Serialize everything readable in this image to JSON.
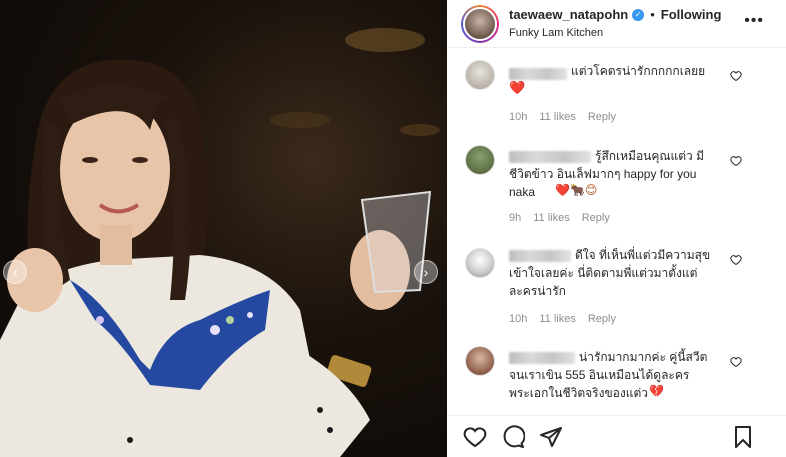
{
  "post": {
    "username": "taewaew_natapohn",
    "separator": "•",
    "follow_status": "Following",
    "location": "Funky Lam Kitchen",
    "more_label": "•••"
  },
  "comments": [
    {
      "text": "แต่วโคตรน่ารักกกกกเลยย",
      "emoji": "❤️",
      "emoji_color": "#d9272e",
      "time": "10h",
      "likes": "11 likes",
      "reply": "Reply"
    },
    {
      "text": "รู้สึกเหมือนคุณแต่ว มีชีวิตข้าว อินเล็ฟมากๆ happy for you naka",
      "emoji": "❤️🐂😊",
      "emoji_color": "#b35a1f",
      "time": "9h",
      "likes": "11 likes",
      "reply": "Reply"
    },
    {
      "text": "ดีใจ ที่เห็นพี่แต่วมีความสุข เข้าใจเลยค่ะ นี่ติดตามพี่แต่วมาตั้งแต่ละครน่ารัก",
      "emoji": "",
      "emoji_color": "#262626",
      "time": "10h",
      "likes": "11 likes",
      "reply": "Reply"
    },
    {
      "text": "น่ารักมากมากค่ะ คู่นี้สวีตจนเราเขิน 555 อินเหมือนได้ดูละครพระเอกในชีวิตจริงของแต่ว",
      "emoji": "💔",
      "emoji_color": "#c2185b",
      "time": "",
      "likes": "",
      "reply": ""
    }
  ],
  "icons": {
    "like": "heart-icon",
    "comment": "comment-icon",
    "share": "share-icon",
    "save": "bookmark-icon",
    "prev": "chevron-left-icon",
    "next": "chevron-right-icon"
  },
  "colors": {
    "verified": "#3897f0",
    "meta_text": "#8e8e8e",
    "primary_text": "#262626"
  }
}
